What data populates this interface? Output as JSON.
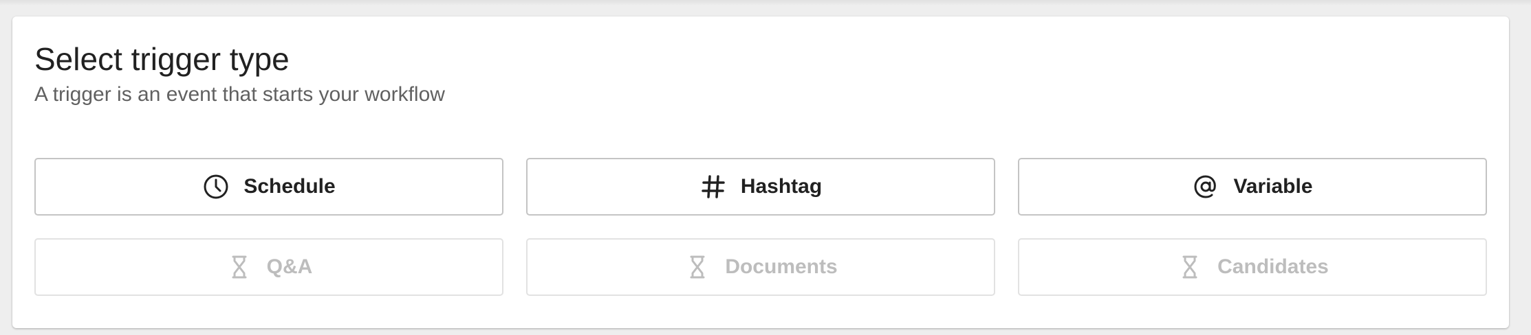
{
  "header": {
    "title": "Select trigger type",
    "subtitle": "A trigger is an event that starts your workflow"
  },
  "options": [
    {
      "label": "Schedule",
      "icon": "clock-icon",
      "enabled": true
    },
    {
      "label": "Hashtag",
      "icon": "hashtag-icon",
      "enabled": true
    },
    {
      "label": "Variable",
      "icon": "at-sign-icon",
      "enabled": true
    },
    {
      "label": "Q&A",
      "icon": "hourglass-icon",
      "enabled": false
    },
    {
      "label": "Documents",
      "icon": "hourglass-icon",
      "enabled": false
    },
    {
      "label": "Candidates",
      "icon": "hourglass-icon",
      "enabled": false
    }
  ],
  "colors": {
    "text": "#212121",
    "subtext": "#616161",
    "border": "#c4c4c4",
    "disabled_text": "#bdbdbd",
    "disabled_border": "#e2e2e2"
  }
}
